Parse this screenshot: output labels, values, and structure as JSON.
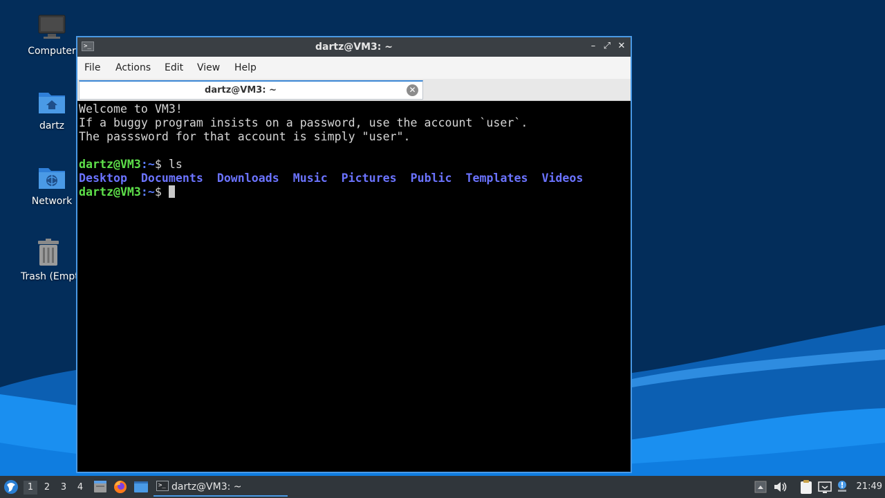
{
  "desktop": {
    "icons": [
      {
        "label": "Computer",
        "icon": "computer-icon"
      },
      {
        "label": "dartz",
        "icon": "home-folder-icon"
      },
      {
        "label": "Network",
        "icon": "network-folder-icon"
      },
      {
        "label": "Trash (Empty)",
        "icon": "trash-icon"
      }
    ]
  },
  "window": {
    "title": "dartz@VM3: ~",
    "menu": [
      "File",
      "Actions",
      "Edit",
      "View",
      "Help"
    ],
    "tab_label": "dartz@VM3: ~",
    "controls": {
      "minimize": "–",
      "maximize": "⤢",
      "close": "✕"
    }
  },
  "terminal": {
    "welcome": [
      "Welcome to VM3!",
      "If a buggy program insists on a password, use the account `user`.",
      "The passsword for that account is simply \"user\"."
    ],
    "prompt_user": "dartz@VM3",
    "prompt_path": ":~",
    "prompt_symbol": "$ ",
    "command": "ls",
    "ls_output": [
      "Desktop",
      "Documents",
      "Downloads",
      "Music",
      "Pictures",
      "Public",
      "Templates",
      "Videos"
    ]
  },
  "taskbar": {
    "workspaces": [
      "1",
      "2",
      "3",
      "4"
    ],
    "active_workspace": "1",
    "task_label": "dartz@VM3: ~",
    "clock": "21:49"
  },
  "colors": {
    "prompt_green": "#5ee04a",
    "dir_blue": "#6b73ff",
    "accent": "#3a86d4"
  }
}
